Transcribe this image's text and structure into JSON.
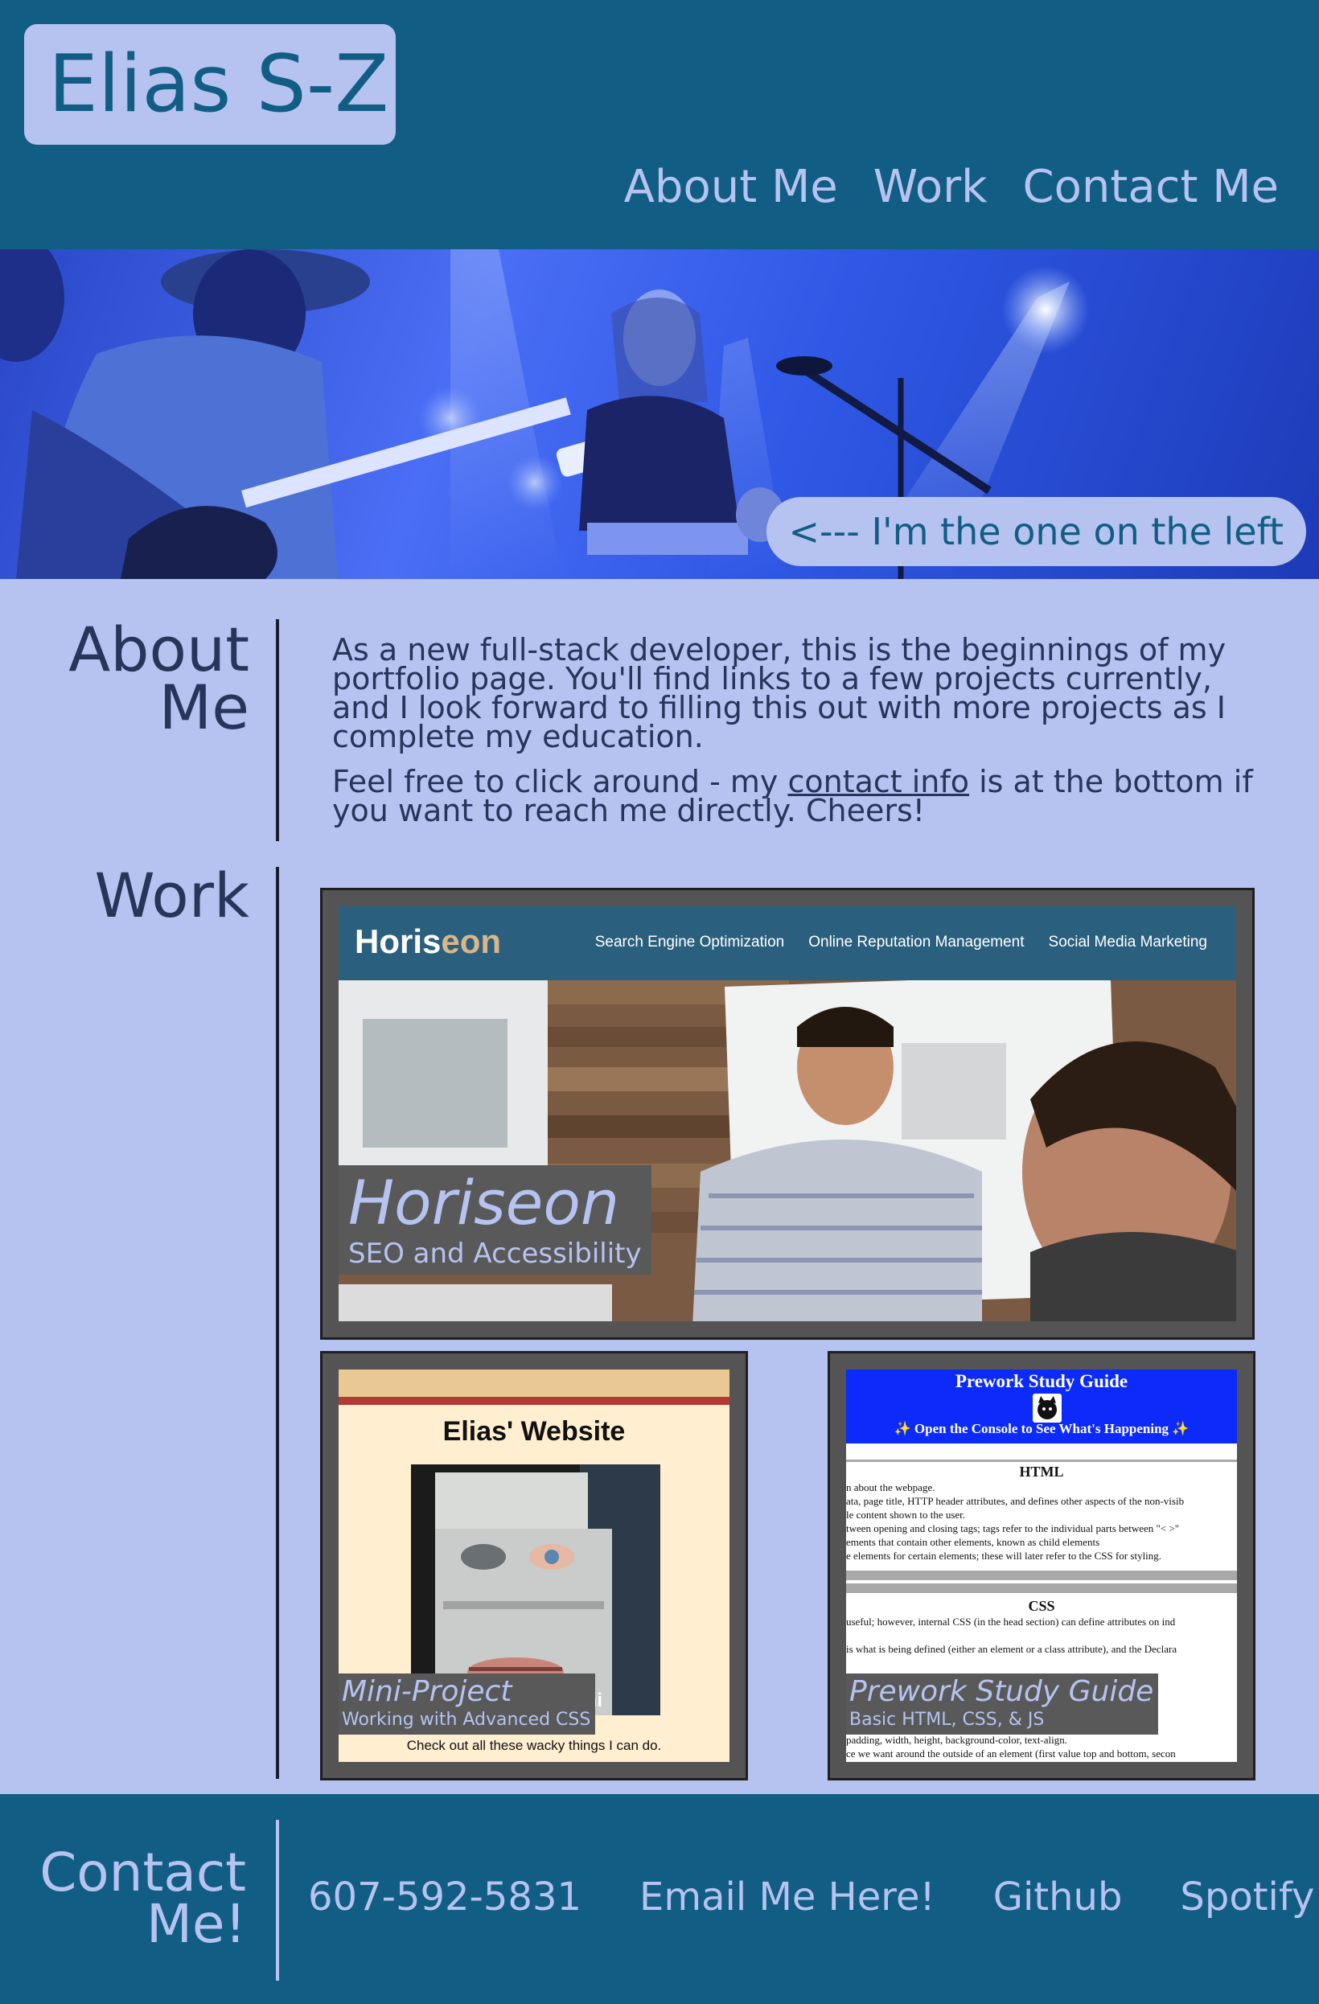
{
  "header": {
    "logo": "Elias S-Z",
    "nav": [
      "About Me",
      "Work",
      "Contact Me"
    ]
  },
  "hero": {
    "caption": "<--- I'm the one on the left"
  },
  "about": {
    "title": "About Me",
    "paragraph1": "As a new full-stack developer, this is the beginnings of my portfolio page. You'll find links to a few projects currently, and I look forward to filling this out with more projects as I complete my education.",
    "paragraph2_before": "Feel free to click around - my ",
    "paragraph2_link": "contact info",
    "paragraph2_after": " is at the bottom if you want to reach me directly. Cheers!"
  },
  "work": {
    "title": "Work",
    "projects": [
      {
        "title": "Horiseon",
        "subtitle": "SEO and Accessibility",
        "screenshot": {
          "logo_main": "Horis",
          "logo_accent": "eon",
          "links": [
            "Search Engine Optimization",
            "Online Reputation Management",
            "Social Media Marketing"
          ]
        }
      },
      {
        "title": "Mini-Project",
        "subtitle": "Working with Advanced CSS",
        "screenshot": {
          "heading": "Elias' Website",
          "photo_caption_fragment": "mi",
          "footer": "Check out all these wacky things I can do."
        }
      },
      {
        "title": "Prework Study Guide",
        "subtitle": "Basic HTML, CSS, & JS",
        "screenshot": {
          "heading": "Prework Study Guide",
          "banner": "✨ Open the Console to See What's Happening ✨",
          "section1_title": "HTML",
          "section1_lines": [
            "n about the webpage.",
            "ata, page title, HTTP header attributes, and defines other aspects of the non-visib",
            "le content shown to the user.",
            "tween opening and closing tags; tags refer to the individual parts between \"< >\"",
            "ements that contain other elements, known as child elements",
            "e elements for certain elements; these will later refer to the CSS for styling."
          ],
          "section2_title": "CSS",
          "section2_lines": [
            " useful; however, internal CSS (in the head section) can define attributes on ind",
            "",
            " is what is being defined (either an element or a class attribute), and the Declara"
          ],
          "bottom_lines": [
            " padding, width, height, background-color, text-align.",
            "ce we want around the outside of an element (first value top and bottom, secon"
          ]
        }
      }
    ]
  },
  "contact": {
    "title": "Contact Me!",
    "links": [
      "607-592-5831",
      "Email Me Here!",
      "Github",
      "Spotify"
    ]
  },
  "colors": {
    "header_bg": "#125d84",
    "page_bg": "#b6c3f0",
    "text_dark": "#27355a",
    "card_bg": "#545454"
  }
}
